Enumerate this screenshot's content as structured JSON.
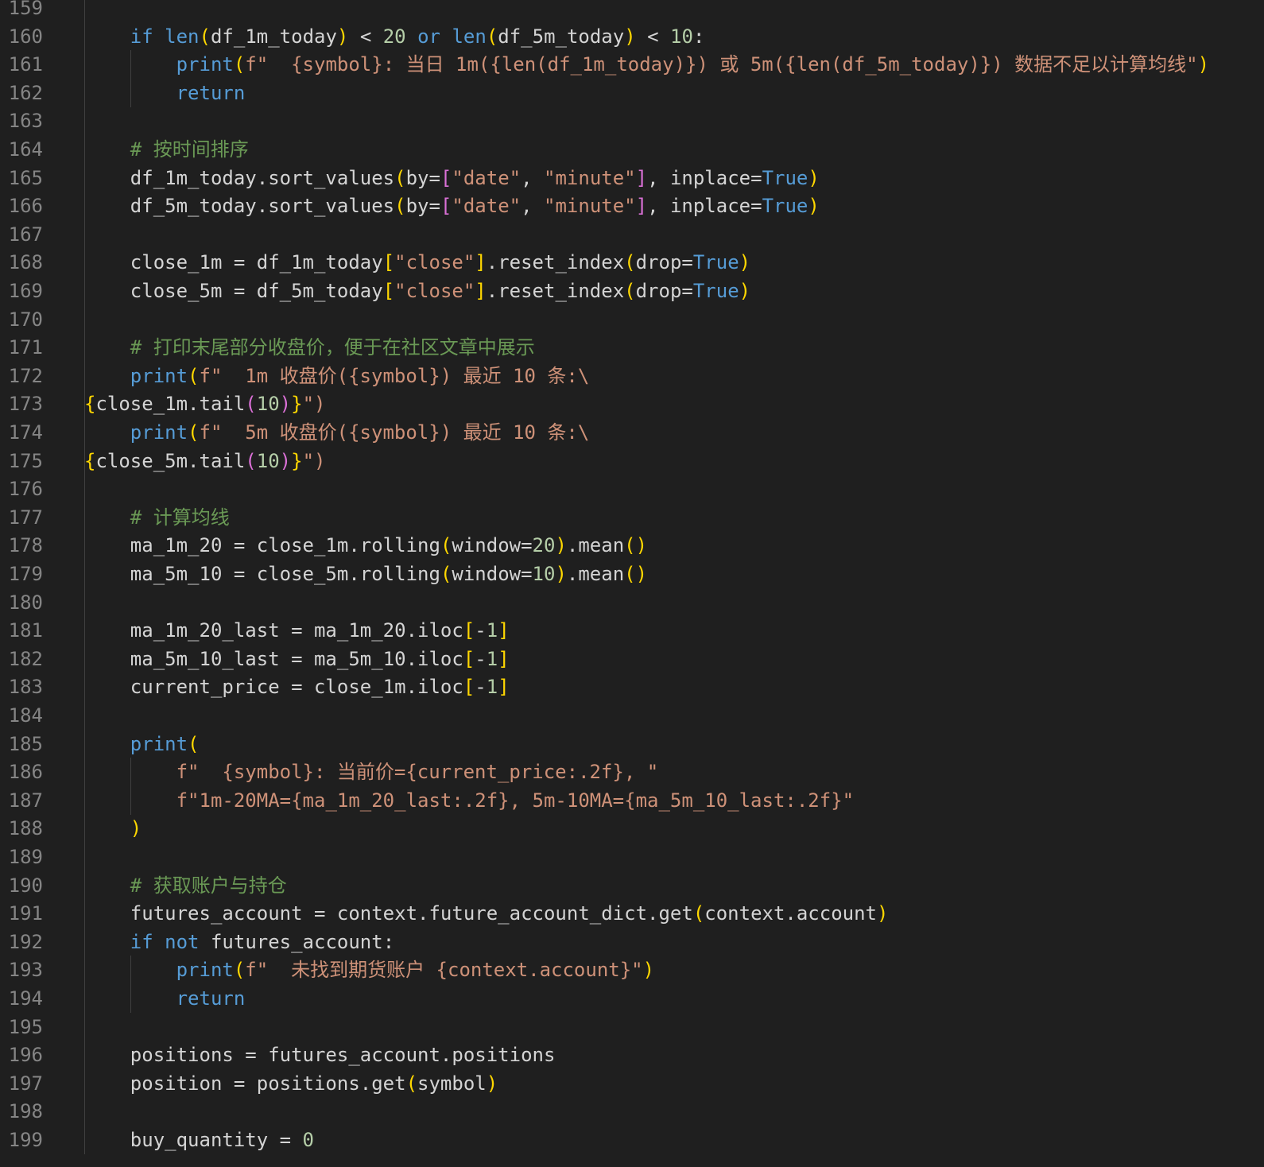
{
  "editor": {
    "language": "python",
    "colors": {
      "background": "#1f1f1f",
      "line_number": "#858585",
      "text": "#d4d4d4",
      "keyword": "#569cd6",
      "function": "#dcdcaa",
      "string": "#ce9178",
      "number": "#b5cea8",
      "comment": "#6a9955",
      "bracket_1": "#ffd700",
      "bracket_2": "#da70d6",
      "bracket_3": "#179fff",
      "indent_guide": "#404040"
    },
    "lines": [
      {
        "n": "159",
        "text": ""
      },
      {
        "n": "160",
        "text": "    if len(df_1m_today) < 20 or len(df_5m_today) < 10:"
      },
      {
        "n": "161",
        "text": "        print(f\"  {symbol}: 当日 1m({len(df_1m_today)}) 或 5m({len(df_5m_today)}) 数据不足以计算均线\")"
      },
      {
        "n": "162",
        "text": "        return"
      },
      {
        "n": "163",
        "text": ""
      },
      {
        "n": "164",
        "text": "    # 按时间排序"
      },
      {
        "n": "165",
        "text": "    df_1m_today.sort_values(by=[\"date\", \"minute\"], inplace=True)"
      },
      {
        "n": "166",
        "text": "    df_5m_today.sort_values(by=[\"date\", \"minute\"], inplace=True)"
      },
      {
        "n": "167",
        "text": ""
      },
      {
        "n": "168",
        "text": "    close_1m = df_1m_today[\"close\"].reset_index(drop=True)"
      },
      {
        "n": "169",
        "text": "    close_5m = df_5m_today[\"close\"].reset_index(drop=True)"
      },
      {
        "n": "170",
        "text": ""
      },
      {
        "n": "171",
        "text": "    # 打印末尾部分收盘价，便于在社区文章中展示"
      },
      {
        "n": "172",
        "text": "    print(f\"  1m 收盘价({symbol}) 最近 10 条:\\"
      },
      {
        "n": "173",
        "text": "{close_1m.tail(10)}\")"
      },
      {
        "n": "174",
        "text": "    print(f\"  5m 收盘价({symbol}) 最近 10 条:\\"
      },
      {
        "n": "175",
        "text": "{close_5m.tail(10)}\")"
      },
      {
        "n": "176",
        "text": ""
      },
      {
        "n": "177",
        "text": "    # 计算均线"
      },
      {
        "n": "178",
        "text": "    ma_1m_20 = close_1m.rolling(window=20).mean()"
      },
      {
        "n": "179",
        "text": "    ma_5m_10 = close_5m.rolling(window=10).mean()"
      },
      {
        "n": "180",
        "text": ""
      },
      {
        "n": "181",
        "text": "    ma_1m_20_last = ma_1m_20.iloc[-1]"
      },
      {
        "n": "182",
        "text": "    ma_5m_10_last = ma_5m_10.iloc[-1]"
      },
      {
        "n": "183",
        "text": "    current_price = close_1m.iloc[-1]"
      },
      {
        "n": "184",
        "text": ""
      },
      {
        "n": "185",
        "text": "    print("
      },
      {
        "n": "186",
        "text": "        f\"  {symbol}: 当前价={current_price:.2f}, \""
      },
      {
        "n": "187",
        "text": "        f\"1m-20MA={ma_1m_20_last:.2f}, 5m-10MA={ma_5m_10_last:.2f}\""
      },
      {
        "n": "188",
        "text": "    )"
      },
      {
        "n": "189",
        "text": ""
      },
      {
        "n": "190",
        "text": "    # 获取账户与持仓"
      },
      {
        "n": "191",
        "text": "    futures_account = context.future_account_dict.get(context.account)"
      },
      {
        "n": "192",
        "text": "    if not futures_account:"
      },
      {
        "n": "193",
        "text": "        print(f\"  未找到期货账户 {context.account}\")"
      },
      {
        "n": "194",
        "text": "        return"
      },
      {
        "n": "195",
        "text": ""
      },
      {
        "n": "196",
        "text": "    positions = futures_account.positions"
      },
      {
        "n": "197",
        "text": "    position = positions.get(symbol)"
      },
      {
        "n": "198",
        "text": ""
      },
      {
        "n": "199",
        "text": "    buy_quantity = 0"
      }
    ]
  }
}
